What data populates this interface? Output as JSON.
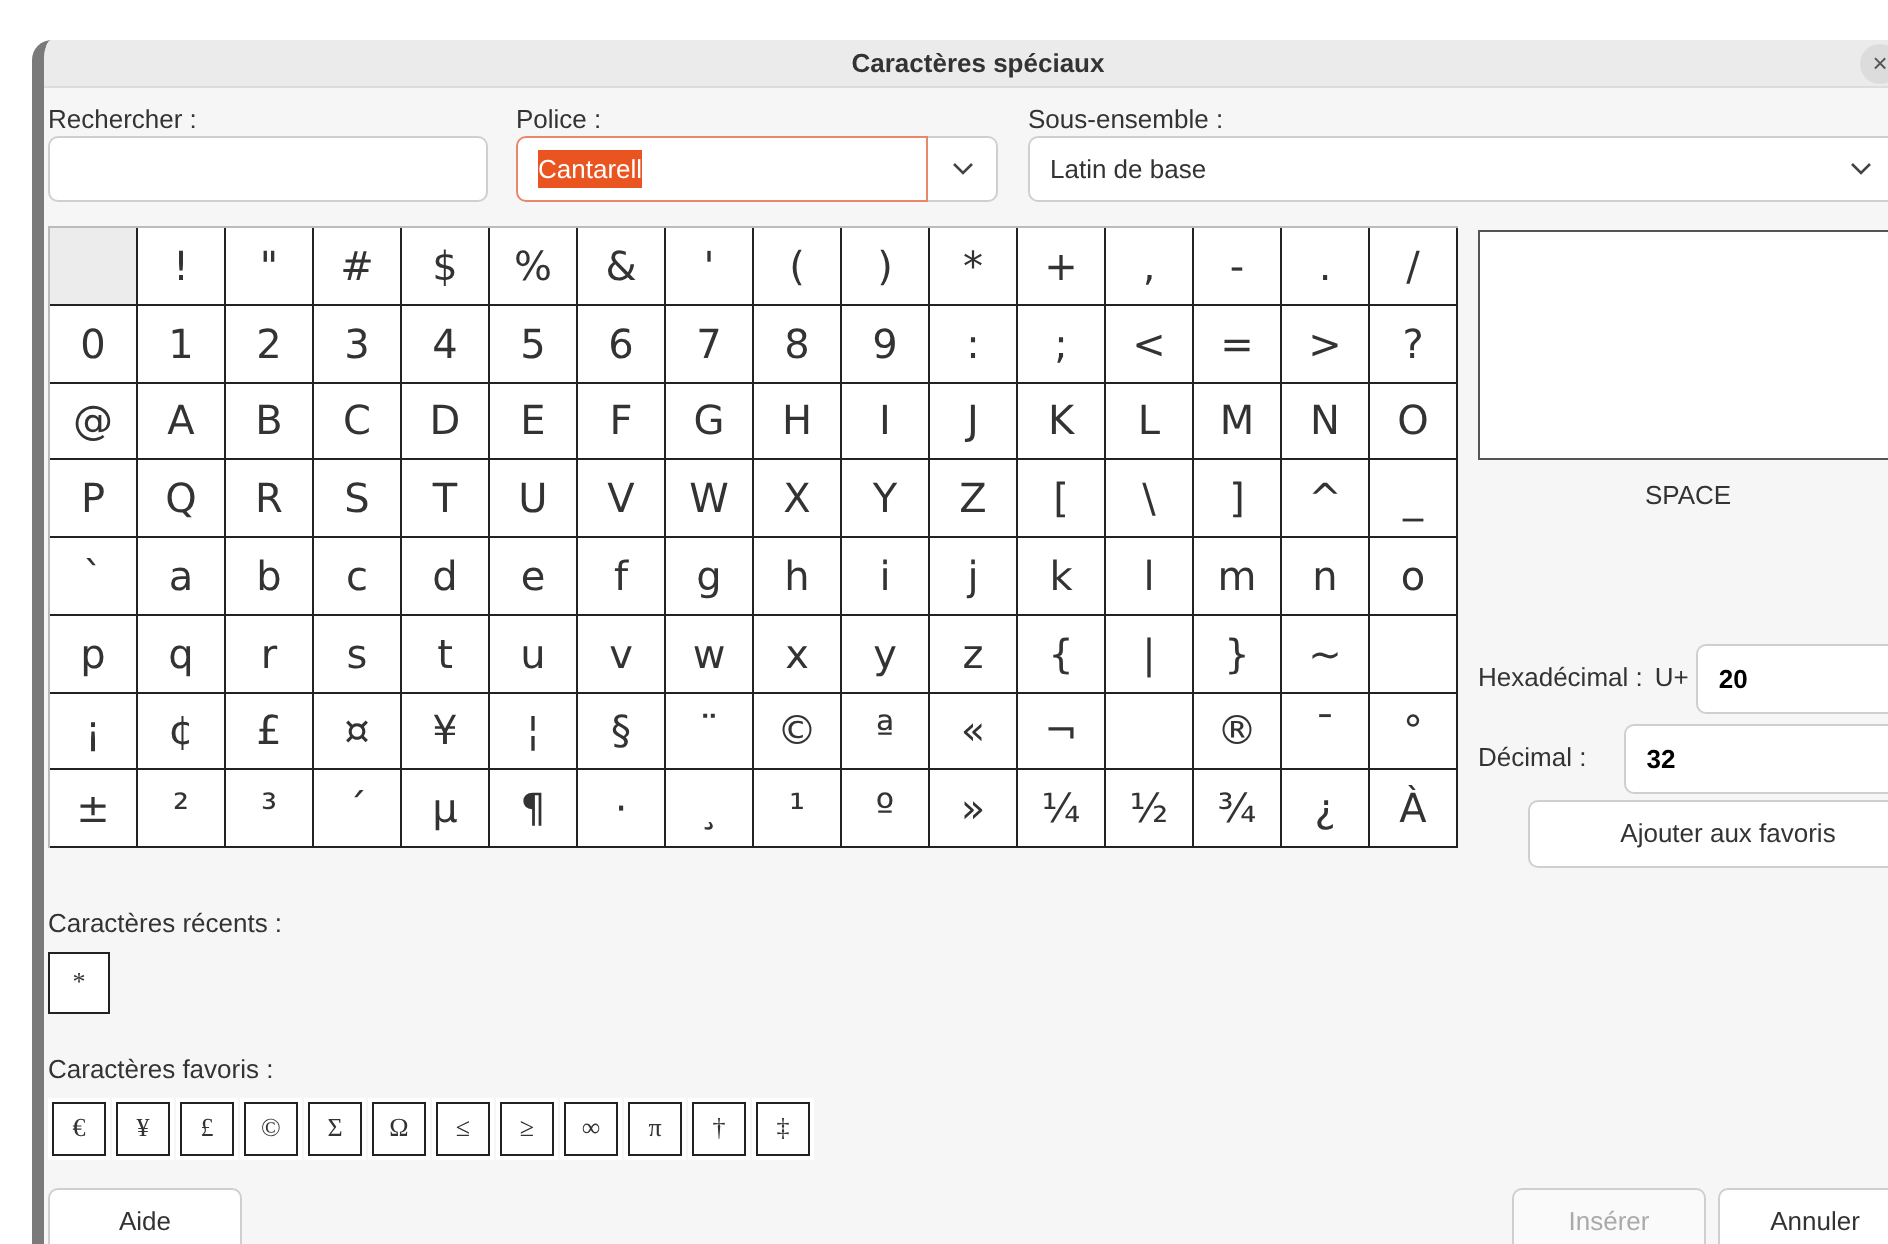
{
  "window": {
    "title": "Caractères spéciaux",
    "close_glyph": "×"
  },
  "search": {
    "label": "Rechercher :"
  },
  "font": {
    "label": "Police :",
    "value": "Cantarell",
    "focused": true,
    "text_selected": true
  },
  "subset": {
    "label": "Sous-ensemble :",
    "value": "Latin de base"
  },
  "grid": [
    [
      {
        "selected": true
      },
      {
        "char": "!",
        "selected": false
      },
      {
        "char": "\"",
        "selected": false
      },
      {
        "char": "#",
        "selected": false
      },
      {
        "char": "$",
        "selected": false
      },
      {
        "char": "%",
        "selected": false
      },
      {
        "char": "&",
        "selected": false
      },
      {
        "char": "'",
        "selected": false
      },
      {
        "char": "(",
        "selected": false
      },
      {
        "char": ")",
        "selected": false
      },
      {
        "char": "*",
        "selected": false
      },
      {
        "char": "+",
        "selected": false
      },
      {
        "char": ",",
        "selected": false
      },
      {
        "char": "-",
        "selected": false
      },
      {
        "char": ".",
        "selected": false
      },
      {
        "char": "/",
        "selected": false
      }
    ],
    [
      {
        "char": "0",
        "selected": false
      },
      {
        "char": "1",
        "selected": false
      },
      {
        "char": "2",
        "selected": false
      },
      {
        "char": "3",
        "selected": false
      },
      {
        "char": "4",
        "selected": false
      },
      {
        "char": "5",
        "selected": false
      },
      {
        "char": "6",
        "selected": false
      },
      {
        "char": "7",
        "selected": false
      },
      {
        "char": "8",
        "selected": false
      },
      {
        "char": "9",
        "selected": false
      },
      {
        "char": ":",
        "selected": false
      },
      {
        "char": ";",
        "selected": false
      },
      {
        "char": "<",
        "selected": false
      },
      {
        "char": "=",
        "selected": false
      },
      {
        "char": ">",
        "selected": false
      },
      {
        "char": "?",
        "selected": false
      }
    ],
    [
      {
        "char": "@",
        "selected": false
      },
      {
        "char": "A",
        "selected": false
      },
      {
        "char": "B",
        "selected": false
      },
      {
        "char": "C",
        "selected": false
      },
      {
        "char": "D",
        "selected": false
      },
      {
        "char": "E",
        "selected": false
      },
      {
        "char": "F",
        "selected": false
      },
      {
        "char": "G",
        "selected": false
      },
      {
        "char": "H",
        "selected": false
      },
      {
        "char": "I",
        "selected": false
      },
      {
        "char": "J",
        "selected": false
      },
      {
        "char": "K",
        "selected": false
      },
      {
        "char": "L",
        "selected": false
      },
      {
        "char": "M",
        "selected": false
      },
      {
        "char": "N",
        "selected": false
      },
      {
        "char": "O",
        "selected": false
      }
    ],
    [
      {
        "char": "P",
        "selected": false
      },
      {
        "char": "Q",
        "selected": false
      },
      {
        "char": "R",
        "selected": false
      },
      {
        "char": "S",
        "selected": false
      },
      {
        "char": "T",
        "selected": false
      },
      {
        "char": "U",
        "selected": false
      },
      {
        "char": "V",
        "selected": false
      },
      {
        "char": "W",
        "selected": false
      },
      {
        "char": "X",
        "selected": false
      },
      {
        "char": "Y",
        "selected": false
      },
      {
        "char": "Z",
        "selected": false
      },
      {
        "char": "[",
        "selected": false
      },
      {
        "char": "\\",
        "selected": false
      },
      {
        "char": "]",
        "selected": false
      },
      {
        "char": "^",
        "selected": false
      },
      {
        "char": "_",
        "selected": false
      }
    ],
    [
      {
        "char": "`",
        "selected": false
      },
      {
        "char": "a",
        "selected": false
      },
      {
        "char": "b",
        "selected": false
      },
      {
        "char": "c",
        "selected": false
      },
      {
        "char": "d",
        "selected": false
      },
      {
        "char": "e",
        "selected": false
      },
      {
        "char": "f",
        "selected": false
      },
      {
        "char": "g",
        "selected": false
      },
      {
        "char": "h",
        "selected": false
      },
      {
        "char": "i",
        "selected": false
      },
      {
        "char": "j",
        "selected": false
      },
      {
        "char": "k",
        "selected": false
      },
      {
        "char": "l",
        "selected": false
      },
      {
        "char": "m",
        "selected": false
      },
      {
        "char": "n",
        "selected": false
      },
      {
        "char": "o",
        "selected": false
      }
    ],
    [
      {
        "char": "p",
        "selected": false
      },
      {
        "char": "q",
        "selected": false
      },
      {
        "char": "r",
        "selected": false
      },
      {
        "char": "s",
        "selected": false
      },
      {
        "char": "t",
        "selected": false
      },
      {
        "char": "u",
        "selected": false
      },
      {
        "char": "v",
        "selected": false
      },
      {
        "char": "w",
        "selected": false
      },
      {
        "char": "x",
        "selected": false
      },
      {
        "char": "y",
        "selected": false
      },
      {
        "char": "z",
        "selected": false
      },
      {
        "char": "{",
        "selected": false
      },
      {
        "char": "|",
        "selected": false
      },
      {
        "char": "}",
        "selected": false
      },
      {
        "char": "~",
        "selected": false
      },
      {
        "selected": false
      }
    ],
    [
      {
        "char": "¡",
        "selected": false
      },
      {
        "char": "¢",
        "selected": false
      },
      {
        "char": "£",
        "selected": false
      },
      {
        "char": "¤",
        "selected": false
      },
      {
        "char": "¥",
        "selected": false
      },
      {
        "char": "¦",
        "selected": false
      },
      {
        "char": "§",
        "selected": false
      },
      {
        "char": "¨",
        "selected": false
      },
      {
        "char": "©",
        "selected": false
      },
      {
        "char": "ª",
        "selected": false
      },
      {
        "char": "«",
        "selected": false
      },
      {
        "char": "¬",
        "selected": false
      },
      {
        "selected": false
      },
      {
        "char": "®",
        "selected": false
      },
      {
        "char": "¯",
        "selected": false
      },
      {
        "char": "°",
        "selected": false
      }
    ],
    [
      {
        "char": "±",
        "selected": false
      },
      {
        "char": "²",
        "selected": false
      },
      {
        "char": "³",
        "selected": false
      },
      {
        "char": "´",
        "selected": false
      },
      {
        "char": "µ",
        "selected": false
      },
      {
        "char": "¶",
        "selected": false
      },
      {
        "char": "·",
        "selected": false
      },
      {
        "char": "¸",
        "selected": false
      },
      {
        "char": "¹",
        "selected": false
      },
      {
        "char": "º",
        "selected": false
      },
      {
        "char": "»",
        "selected": false
      },
      {
        "char": "¼",
        "selected": false
      },
      {
        "char": "½",
        "selected": false
      },
      {
        "char": "¾",
        "selected": false
      },
      {
        "char": "¿",
        "selected": false
      },
      {
        "char": "À",
        "selected": false
      }
    ]
  ],
  "preview": {
    "name": "SPACE"
  },
  "hex": {
    "label": "Hexadécimal :",
    "prefix": "U+",
    "value": "20"
  },
  "decimal": {
    "label": "Décimal :",
    "value": "32"
  },
  "add_favorite": "Ajouter aux favoris",
  "recent": {
    "label": "Caractères récents :",
    "chars": [
      "*"
    ]
  },
  "favorites": {
    "label": "Caractères favoris :",
    "chars": [
      "€",
      "¥",
      "£",
      "©",
      "Σ",
      "Ω",
      "≤",
      "≥",
      "∞",
      "π",
      "†",
      "‡"
    ]
  },
  "buttons": [
    {
      "label": "Aide",
      "disabled": false,
      "kind": "help"
    },
    {
      "label": "Insérer",
      "disabled": true,
      "kind": "action"
    },
    {
      "label": "Annuler",
      "disabled": false,
      "kind": "action"
    }
  ]
}
